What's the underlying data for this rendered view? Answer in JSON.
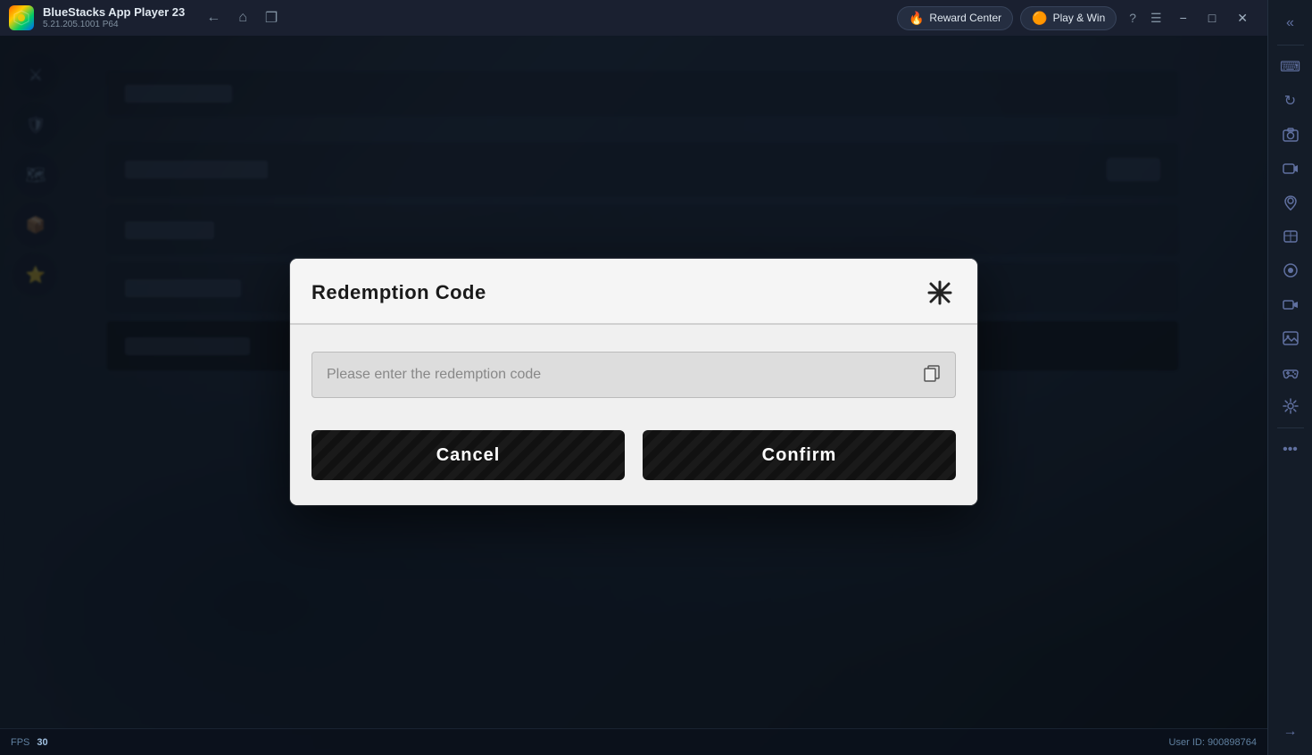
{
  "app": {
    "name": "BlueStacks App Player 23",
    "version": "5.21.205.1001 P64",
    "logo_text": "BS"
  },
  "titlebar": {
    "back_label": "←",
    "home_label": "⌂",
    "tab_label": "❐",
    "reward_center_label": "Reward Center",
    "play_win_label": "Play & Win",
    "help_label": "?",
    "menu_label": "☰",
    "minimize_label": "−",
    "maximize_label": "□",
    "close_label": "✕"
  },
  "bottombar": {
    "fps_label": "FPS",
    "fps_value": "30",
    "user_id_label": "User ID: 900898764"
  },
  "dialog": {
    "title": "Redemption Code",
    "input_placeholder": "Please enter the redemption code",
    "cancel_label": "Cancel",
    "confirm_label": "Confirm",
    "close_icon": "✕",
    "paste_icon": "⧉"
  },
  "sidebar": {
    "icons": [
      {
        "name": "expand-icon",
        "symbol": "«"
      },
      {
        "name": "keyboard-icon",
        "symbol": "⌨"
      },
      {
        "name": "rotate-icon",
        "symbol": "↻"
      },
      {
        "name": "screenshot-icon",
        "symbol": "📷"
      },
      {
        "name": "record-icon",
        "symbol": "⏺"
      },
      {
        "name": "location-icon",
        "symbol": "📍"
      },
      {
        "name": "rpk-icon",
        "symbol": "⬡"
      },
      {
        "name": "capture-icon",
        "symbol": "◉"
      },
      {
        "name": "video-icon",
        "symbol": "▶"
      },
      {
        "name": "image-icon",
        "symbol": "🖼"
      },
      {
        "name": "gamepad-icon",
        "symbol": "🎮"
      },
      {
        "name": "settings-icon",
        "symbol": "⚙"
      },
      {
        "name": "more-icon",
        "symbol": "•••"
      },
      {
        "name": "collapse-icon",
        "symbol": "→"
      }
    ]
  }
}
